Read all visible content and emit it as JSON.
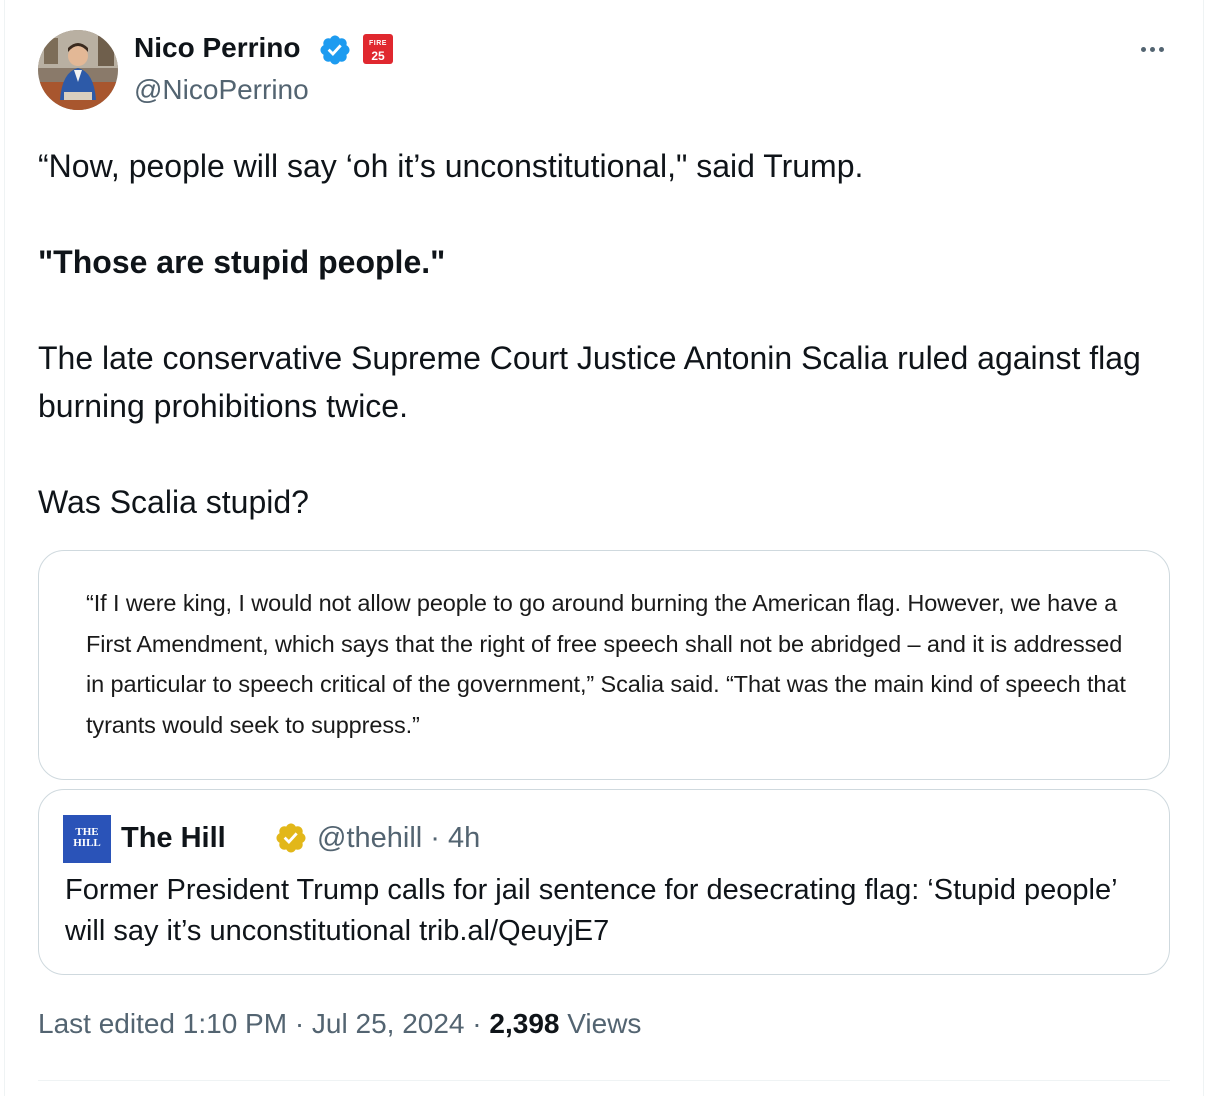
{
  "author": {
    "name": "Nico Perrino",
    "handle": "@NicoPerrino",
    "affiliate_badge": {
      "line1": "FIRE",
      "line2": "25"
    }
  },
  "tweet": {
    "line1": "“Now, people will say ‘oh it’s unconstitutional,\" said Trump.",
    "line2": "\"Those are stupid people.\"",
    "line3": "The late conservative Supreme Court Justice Antonin Scalia ruled against flag burning prohibitions twice.",
    "line4": "Was Scalia stupid?"
  },
  "image_quote": "“If I were king, I would not allow people to go around burning the American flag. However, we have a First Amendment, which says that the right of free speech shall not be abridged – and it is addressed in particular to speech critical of the government,” Scalia said. “That was the main kind of speech that tyrants would seek to suppress.”",
  "quoted_tweet": {
    "logo_text": "THE HILL",
    "name": "The Hill",
    "handle_time": "@thehill · 4h",
    "text": "Former President Trump calls for jail sentence for desecrating flag: ‘Stupid people’ will say it’s unconstitutional trib.al/QeuyjE7"
  },
  "meta": {
    "edited": "Last edited 1:10 PM · Jul 25, 2024 · ",
    "views_count": "2,398",
    "views_label": " Views"
  },
  "colors": {
    "verified_blue": "#1d9bf0",
    "verified_gold": "#e2b719",
    "secondary_text": "#536471",
    "border": "#cfd9de",
    "hill_blue": "#2a53b8",
    "fire_red": "#e0282f"
  }
}
